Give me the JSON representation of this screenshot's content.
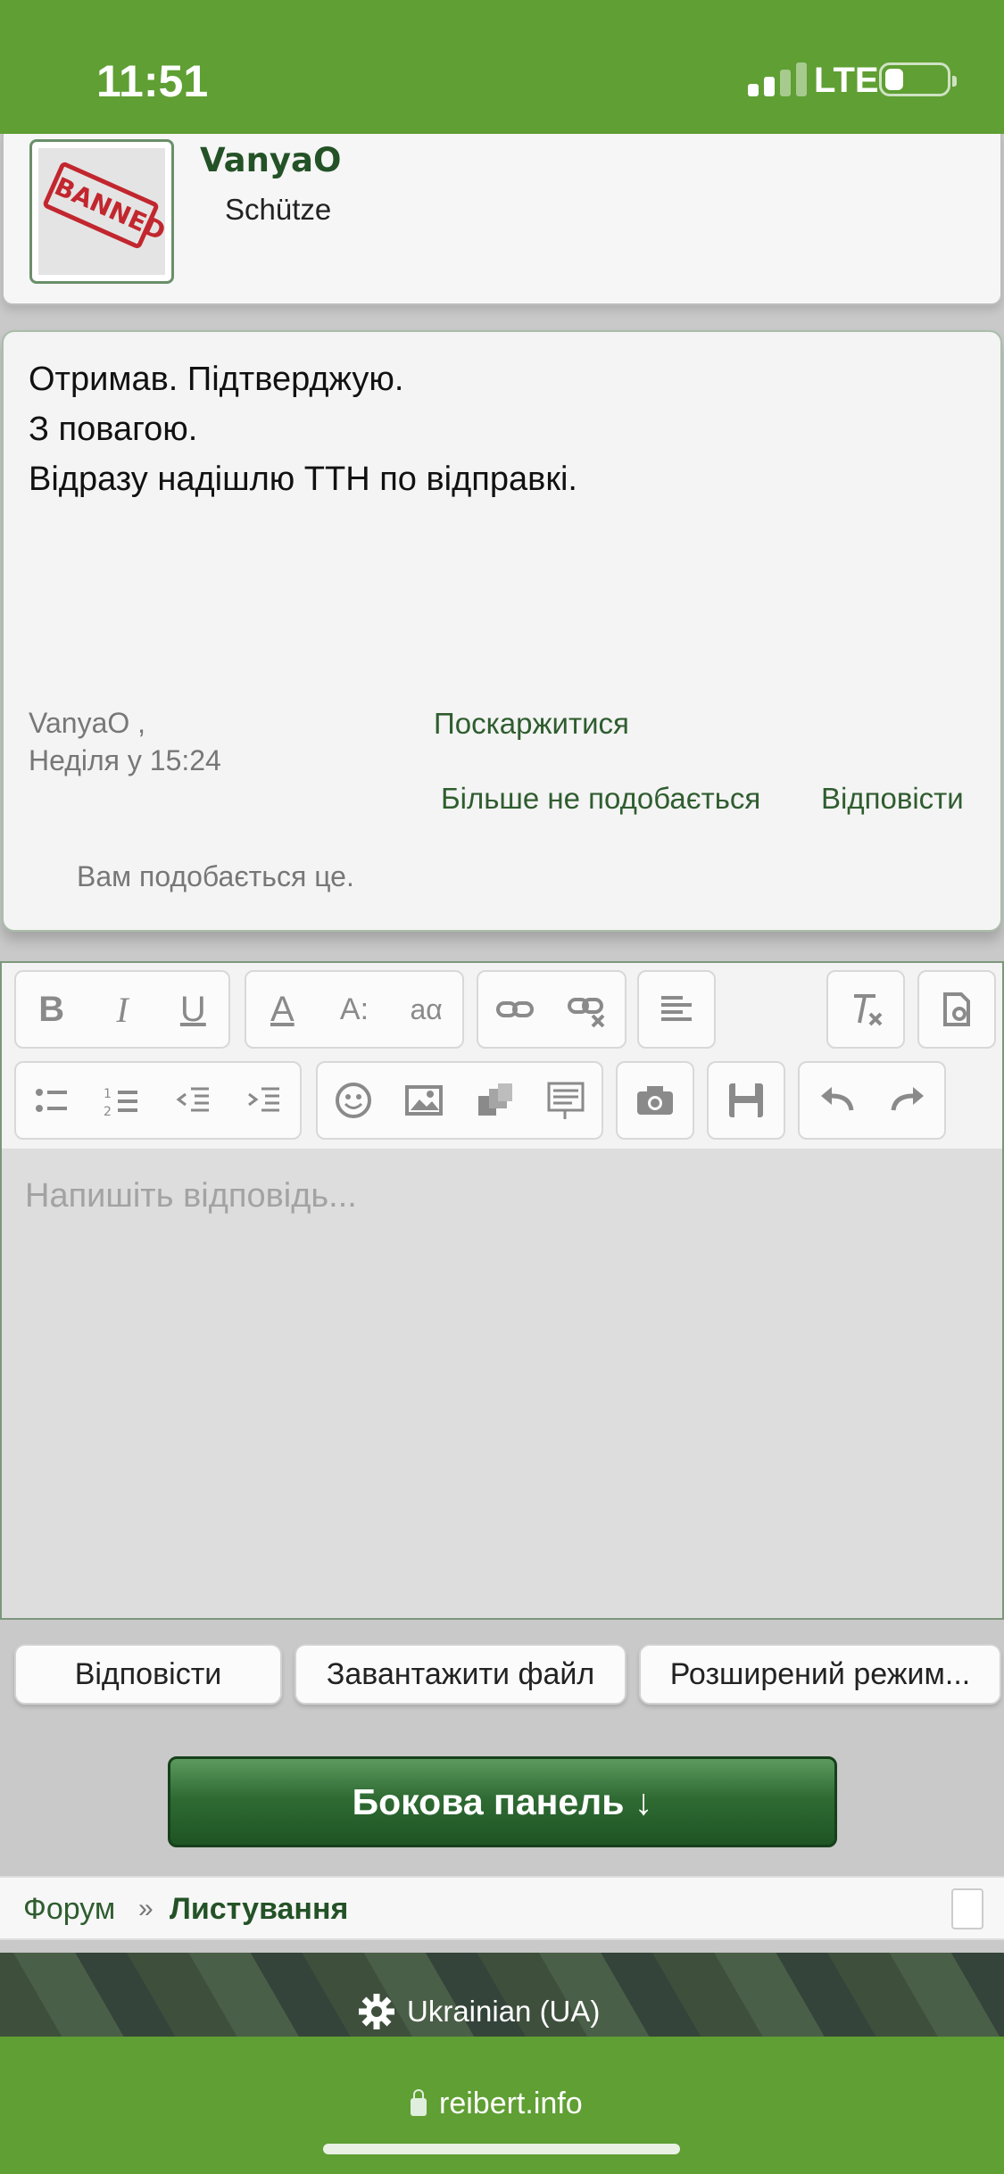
{
  "status": {
    "time": "11:51",
    "network": "LTE",
    "battery_level": 0.3
  },
  "user": {
    "name": "VanyaO",
    "title": "Schütze",
    "avatar_stamp": "BANNED"
  },
  "message": {
    "lines": [
      "Отримав. Підтверджую.",
      "З повагою.",
      "Відразу надішлю ТТН по відправкі."
    ],
    "author": "VanyaO  ,",
    "date": "Неділя у 15:24",
    "report_link": "Поскаржитися",
    "unlike_link": "Більше не подобається",
    "reply_link": "Відповісти",
    "likes_text": "Вам подобається це."
  },
  "editor": {
    "placeholder": "Напишіть відповідь...",
    "toolbar": {
      "bold": "B",
      "italic": "I",
      "underline": "U",
      "font_color": "A",
      "font_size": "A:",
      "font_family": "aα"
    }
  },
  "buttons": {
    "reply": "Відповісти",
    "upload": "Завантажити файл",
    "advanced": "Розширений режим...",
    "sidebar": "Бокова панель ↓"
  },
  "breadcrumb": {
    "forum": "Форум",
    "separator": "»",
    "current": "Листування"
  },
  "footer": {
    "language": "Ukrainian (UA)",
    "url": "reibert.info"
  },
  "colors": {
    "brand_green": "#5f9f33",
    "link_green": "#2f5d2f",
    "button_green": "#2f6b33"
  }
}
